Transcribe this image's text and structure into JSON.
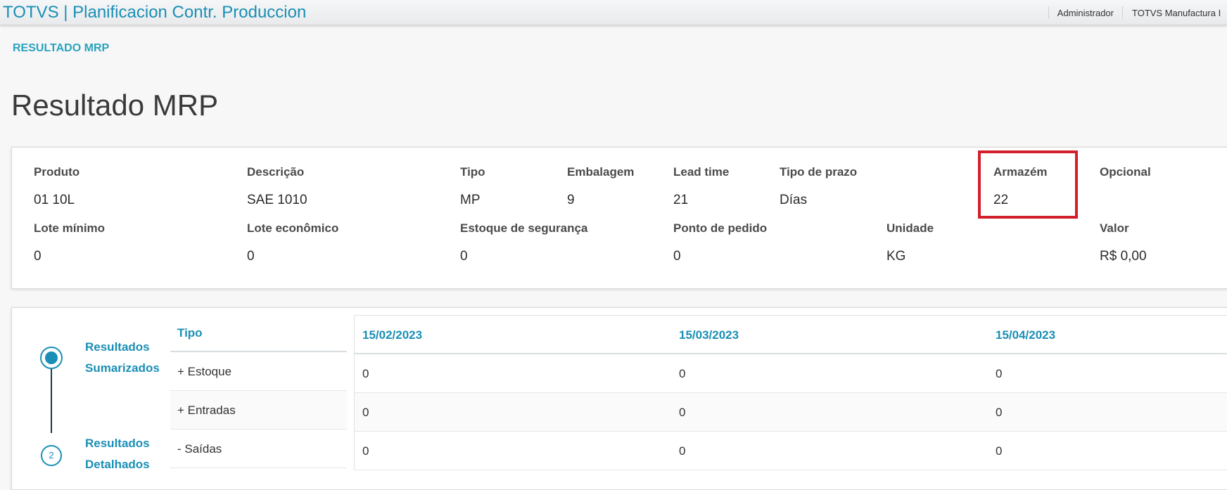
{
  "header": {
    "title": "TOTVS | Planificacion Contr. Produccion",
    "user": "Administrador",
    "company": "TOTVS Manufactura I"
  },
  "breadcrumb": "RESULTADO MRP",
  "page_title": "Resultado MRP",
  "product": {
    "fields": [
      {
        "label": "Produto",
        "value": "01 10L"
      },
      {
        "label": "Descrição",
        "value": "SAE 1010"
      },
      {
        "label": "Tipo",
        "value": "MP"
      },
      {
        "label": "Embalagem",
        "value": "9"
      },
      {
        "label": "Lead time",
        "value": "21"
      },
      {
        "label": "Tipo de prazo",
        "value": "Días"
      },
      {
        "label": "Armazém",
        "value": "22"
      },
      {
        "label": "Opcional",
        "value": ""
      },
      {
        "label": "Lote mínimo",
        "value": "0"
      },
      {
        "label": "Lote econômico",
        "value": "0"
      },
      {
        "label": "Estoque de segurança",
        "value": "0"
      },
      {
        "label": "Ponto de pedido",
        "value": "0"
      },
      {
        "label": "Unidade",
        "value": "KG"
      },
      {
        "label": "Valor",
        "value": "R$ 0,00"
      }
    ]
  },
  "stepper": {
    "steps": [
      {
        "label_line1": "Resultados",
        "label_line2": "Sumarizados"
      },
      {
        "number": "2",
        "label_line1": "Resultados",
        "label_line2": "Detalhados"
      }
    ]
  },
  "results": {
    "type_header": "Tipo",
    "types": [
      "+ Estoque",
      "+ Entradas",
      "- Saídas"
    ],
    "dates": [
      "15/02/2023",
      "15/03/2023",
      "15/04/2023"
    ],
    "rows": [
      [
        "0",
        "0",
        "0"
      ],
      [
        "0",
        "0",
        "0"
      ],
      [
        "0",
        "0",
        "0"
      ]
    ]
  },
  "colors": {
    "accent": "#1a8fb5",
    "highlight": "#d21f2b"
  }
}
